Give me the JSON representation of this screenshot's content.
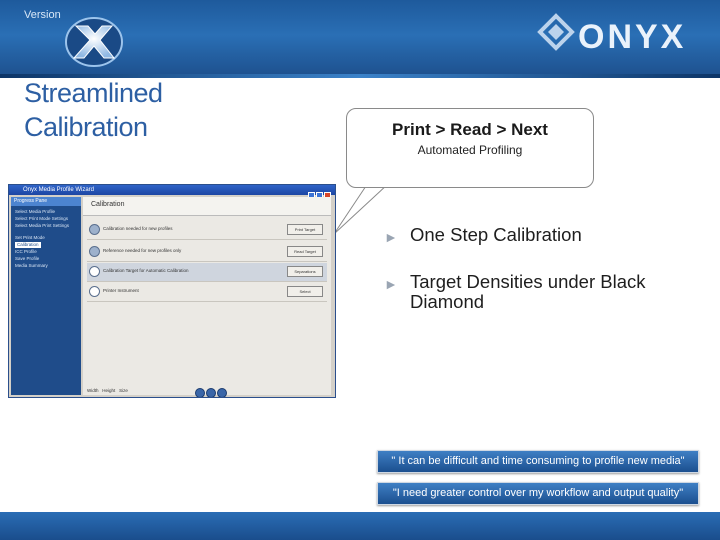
{
  "header": {
    "version_label": "Version",
    "logo_mark": "X",
    "brand": "ONYX"
  },
  "slide": {
    "title_line1": "Streamlined",
    "title_line2": "Calibration"
  },
  "callout": {
    "heading": "Print > Read > Next",
    "subheading": "Automated Profiling"
  },
  "bullets": [
    {
      "text": "One Step Calibration"
    },
    {
      "text": "Target Densities under Black Diamond"
    }
  ],
  "quotes": [
    {
      "text": "\" It can be difficult and time consuming to profile new media\""
    },
    {
      "text": "\"I need greater control over my workflow and output quality\""
    }
  ],
  "screenshot": {
    "window_title": "Onyx Media Profile Wizard",
    "sidebar_header": "Progress Pane",
    "sidebar_items": [
      {
        "label": "Select Media Profile"
      },
      {
        "label": "Select Print Mode Settings"
      },
      {
        "label": "Select Media Print Settings"
      },
      {
        "label": "Set Print Mode"
      },
      {
        "label": "Calibration",
        "selected": true
      },
      {
        "label": "ICC Profile"
      },
      {
        "label": "Save Profile"
      },
      {
        "label": "Media Summary"
      }
    ],
    "panel_title": "Calibration",
    "rows": [
      {
        "label": "Calibration needed for new profiles",
        "button": "Print Target"
      },
      {
        "label": "Reference needed for new profiles only",
        "button": "Read Target"
      },
      {
        "label": "Calibration Target for Automatic Calibration",
        "button": "Separations"
      },
      {
        "label": "Printer Instrument",
        "button": "Select"
      }
    ],
    "footer_options": [
      "Width",
      "Height",
      "Size"
    ]
  },
  "colors": {
    "brand_blue": "#2a6fb5",
    "title_blue": "#2d5fa3",
    "quote_blue": "#2b66ad"
  }
}
